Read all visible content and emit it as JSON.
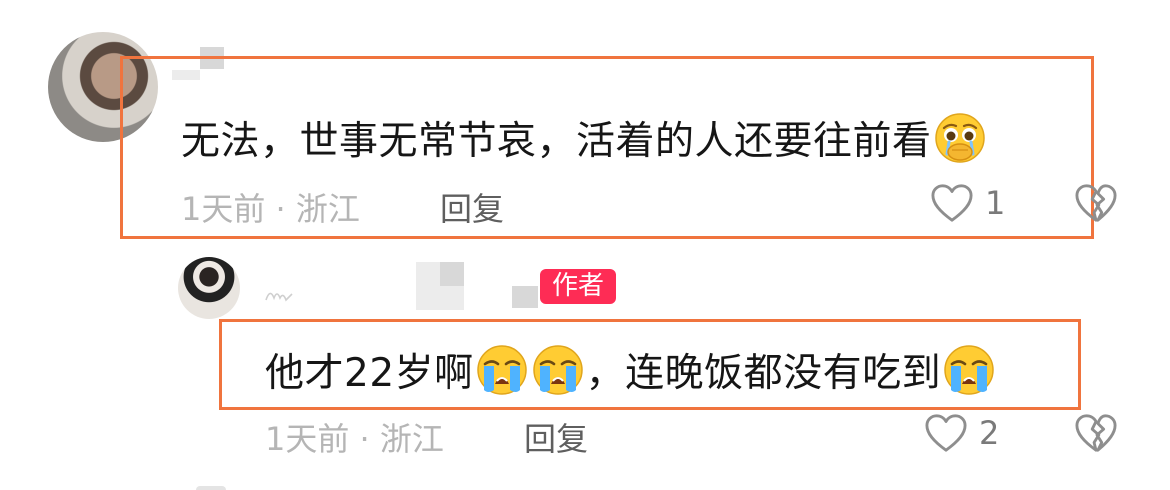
{
  "comments": [
    {
      "text": "无法，世事无常节哀，活着的人还要往前看",
      "emoji_after": "pleading-face-icon",
      "time_location": "1天前 · 浙江",
      "reply_label": "回复",
      "like_count": "1"
    },
    {
      "author_badge": "作者",
      "text_part1": "他才22岁啊",
      "text_part2": "，连晚饭都没有吃到",
      "emojis": [
        "loudly-crying-face-icon",
        "loudly-crying-face-icon",
        "loudly-crying-face-icon"
      ],
      "time_location": "1天前 · 浙江",
      "reply_label": "回复",
      "like_count": "2"
    }
  ],
  "colors": {
    "highlight_border": "#f0743e",
    "author_badge": "#fe2c55",
    "meta_text": "#b5b5b5",
    "reply_text": "#5f5f5f"
  }
}
